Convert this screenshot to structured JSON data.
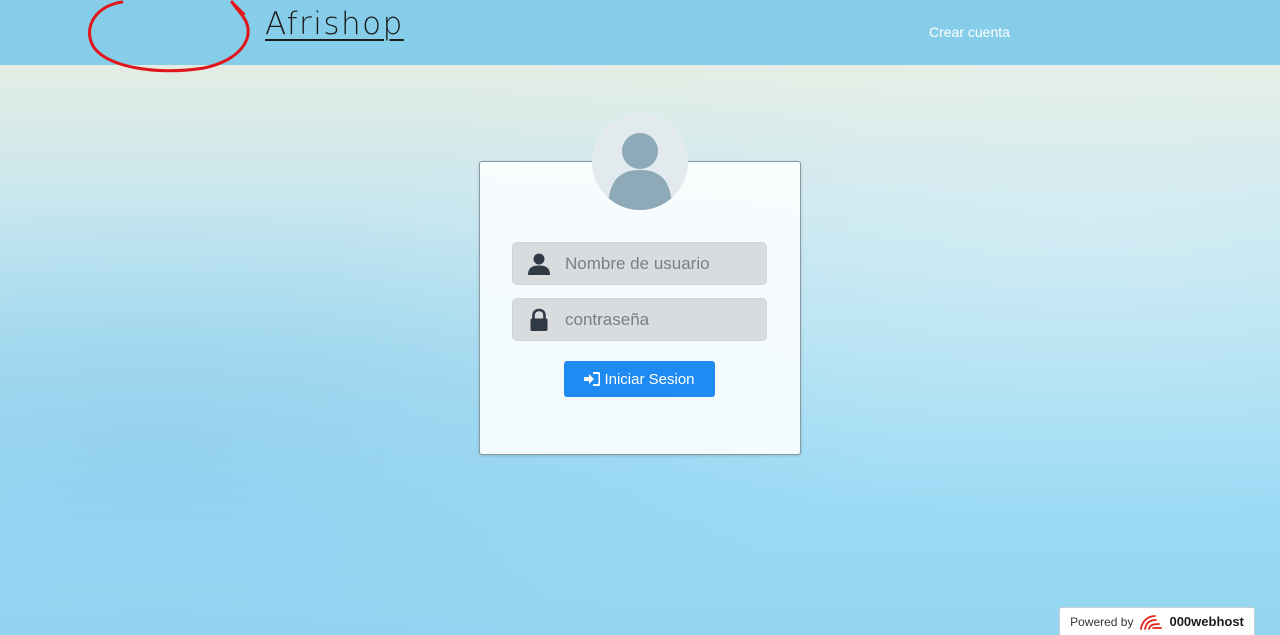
{
  "navbar": {
    "brand": "Afrishop",
    "create_account": "Crear cuenta",
    "background_color": "#86cde9"
  },
  "login": {
    "username_placeholder": "Nombre de usuario",
    "password_placeholder": "contraseña",
    "submit_label": "Iniciar Sesion",
    "submit_icon": "sign-in-icon",
    "accent_color": "#1f8bf2"
  },
  "footer": {
    "powered_by": "Powered by",
    "host_name": "000webhost"
  }
}
